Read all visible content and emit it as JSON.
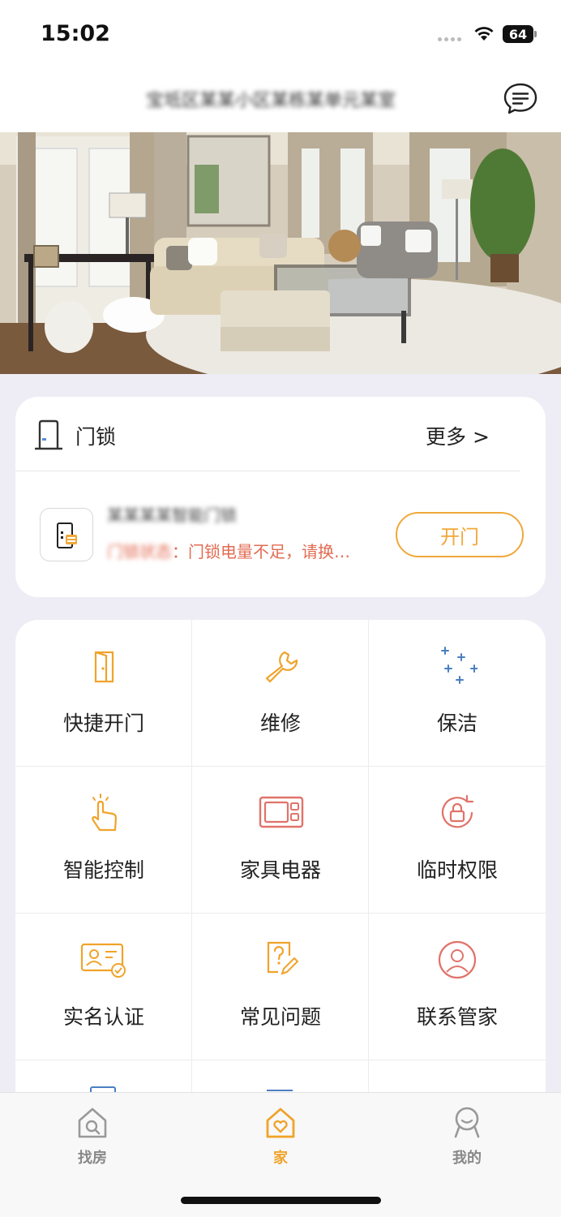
{
  "status_bar": {
    "time": "15:02",
    "battery": "64"
  },
  "header": {
    "title": "宝坻区某某小区某栋某单元某室"
  },
  "lock_card": {
    "title": "门锁",
    "more": "更多 >",
    "device_name": "某某某某智能门锁",
    "status_prefix": "门锁状态",
    "status_warning": "：门锁电量不足，请换…",
    "open_button": "开门"
  },
  "grid": {
    "items": [
      {
        "label": "快捷开门",
        "icon": "door-open-icon",
        "color": "#f0a32a"
      },
      {
        "label": "维修",
        "icon": "wrench-icon",
        "color": "#f0a32a"
      },
      {
        "label": "保洁",
        "icon": "sparkle-icon",
        "color": "#4a7fc1"
      },
      {
        "label": "智能控制",
        "icon": "tap-hand-icon",
        "color": "#f0a32a"
      },
      {
        "label": "家具电器",
        "icon": "microwave-icon",
        "color": "#e0736a"
      },
      {
        "label": "临时权限",
        "icon": "lock-rotate-icon",
        "color": "#e0736a"
      },
      {
        "label": "实名认证",
        "icon": "id-card-icon",
        "color": "#f0a32a"
      },
      {
        "label": "常见问题",
        "icon": "question-doc-icon",
        "color": "#f0a32a"
      },
      {
        "label": "联系管家",
        "icon": "butler-icon",
        "color": "#e0736a"
      }
    ]
  },
  "tab_bar": {
    "tabs": [
      {
        "label": "找房",
        "icon": "house-search-icon",
        "active": false
      },
      {
        "label": "家",
        "icon": "home-heart-icon",
        "active": true
      },
      {
        "label": "我的",
        "icon": "profile-icon",
        "active": false
      }
    ]
  },
  "colors": {
    "accent": "#f0a32a",
    "warning": "#e26b52",
    "background": "#eeedf5"
  }
}
